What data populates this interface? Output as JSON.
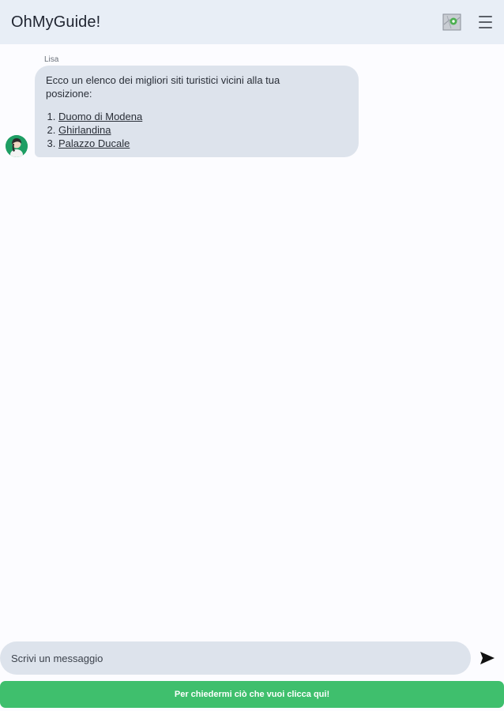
{
  "header": {
    "title": "OhMyGuide!",
    "map_icon": "map-icon",
    "menu_icon": "hamburger-menu-icon"
  },
  "chat": {
    "messages": [
      {
        "sender": "Lisa",
        "text": "Ecco un elenco dei migliori siti turistici vicini alla tua posizione:",
        "links": [
          "Duomo di Modena",
          "Ghirlandina",
          "Palazzo Ducale"
        ],
        "avatar_icon": "guide-avatar-icon"
      }
    ]
  },
  "composer": {
    "placeholder": "Scrivi un messaggio",
    "send_icon": "send-icon"
  },
  "cta": {
    "label": "Per chiedermi ciò che vuoi clicca qui!"
  },
  "colors": {
    "header_bg": "#e8eef6",
    "bubble_bg": "#dde3ec",
    "cta_bg": "#3fbf6d",
    "avatar_bg": "#1e9e64"
  }
}
